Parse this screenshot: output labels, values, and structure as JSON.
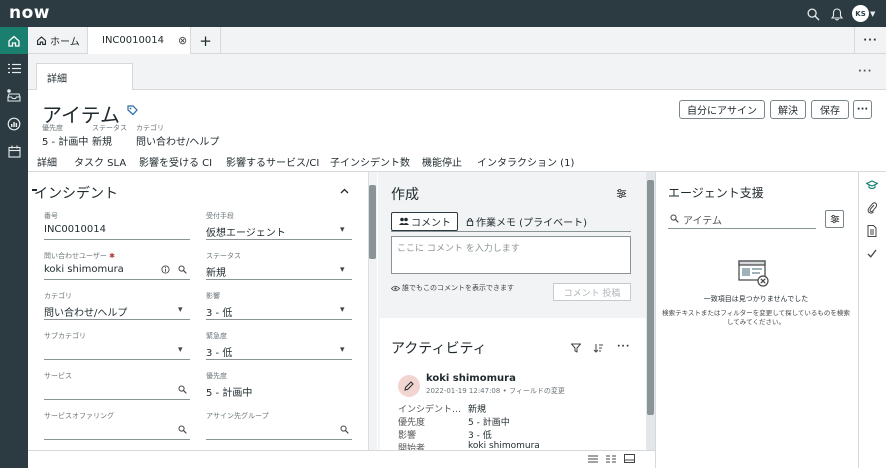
{
  "brand": {
    "logo": "now",
    "accent": "#1a7f6e",
    "chrome": "#2c3b41"
  },
  "topbar": {
    "avatar_initials": "KS"
  },
  "tabs": {
    "home": "ホーム",
    "record": "INC0010014",
    "close_glyph": "⊗",
    "add_glyph": "+",
    "more_glyph": "···"
  },
  "subtab": {
    "label": "詳細",
    "more_glyph": "···"
  },
  "header": {
    "title": "アイテム",
    "meta": [
      {
        "label": "優先度",
        "value": "5 - 計画中"
      },
      {
        "label": "ステータス",
        "value": "新規"
      },
      {
        "label": "カテゴリ",
        "value": "問い合わせ/ヘルプ"
      }
    ],
    "buttons": {
      "assign_me": "自分にアサイン",
      "resolve": "解決",
      "save": "保存",
      "more": "···"
    }
  },
  "nav_tabs": [
    "詳細",
    "タスク SLA",
    "影響を受ける CI",
    "影響するサービス/CI",
    "子インシデント数",
    "機能停止",
    "インタラクション (1)"
  ],
  "form": {
    "section_title": "インシデント",
    "fields": [
      {
        "label": "番号",
        "value": "INC0010014"
      },
      {
        "label": "受付手段",
        "value": "仮想エージェント"
      },
      {
        "label": "問い合わせユーザー",
        "value": "koki shimomura"
      },
      {
        "label": "ステータス",
        "value": "新規"
      },
      {
        "label": "カテゴリ",
        "value": "問い合わせ/ヘルプ"
      },
      {
        "label": "影響",
        "value": "3 - 低"
      },
      {
        "label": "サブカテゴリ",
        "value": ""
      },
      {
        "label": "緊急度",
        "value": "3 - 低"
      },
      {
        "label": "サービス",
        "value": ""
      },
      {
        "label": "優先度",
        "value": "5 - 計画中"
      },
      {
        "label": "サービスオファリング",
        "value": ""
      },
      {
        "label": "アサイン先グループ",
        "value": ""
      }
    ],
    "required_mark": "✱"
  },
  "compose": {
    "title": "作成",
    "tab_comment": "コメント",
    "tab_worknote": "作業メモ (プライベート)",
    "placeholder": "ここに コメント を入力します",
    "visibility_note": "誰でもこのコメントを表示できます",
    "post_button": "コメント 投稿"
  },
  "activity": {
    "title": "アクティビティ",
    "entry": {
      "user": "koki shimomura",
      "time": "2022-01-19 12:47:08",
      "type": "フィールドの変更",
      "changes": [
        {
          "field": "インシデント…",
          "value": "新規"
        },
        {
          "field": "優先度",
          "value": "5 - 計画中"
        },
        {
          "field": "影響",
          "value": "3 - 低"
        },
        {
          "field": "開始者",
          "value": "koki shimomura"
        }
      ]
    }
  },
  "agent_assist": {
    "title": "エージェント支援",
    "search_value": "アイテム",
    "empty_title": "一致項目は見つかりませんでした",
    "empty_hint_line1": "検索テキストまたはフィルターを変更して探しているものを検索",
    "empty_hint_line2": "してみてください。"
  }
}
